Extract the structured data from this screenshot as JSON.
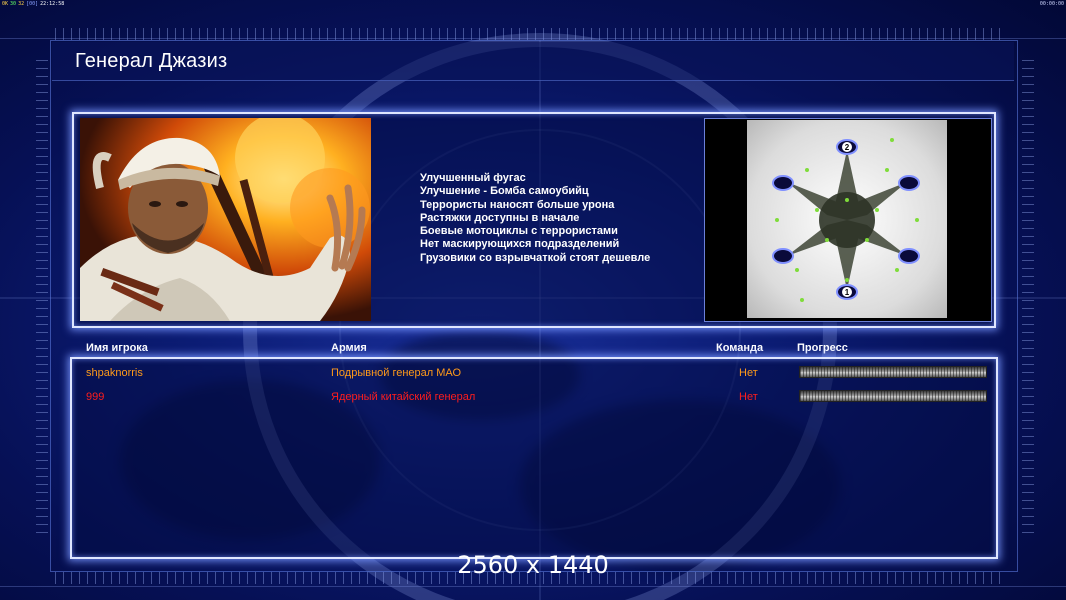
{
  "status_bar": {
    "left_items": [
      {
        "text": "0K",
        "color": "#ffd24a"
      },
      {
        "text": "30",
        "color": "#66ff66"
      },
      {
        "text": "32",
        "color": "#ffd24a"
      },
      {
        "text": "[00]",
        "color": "#8aa0ff"
      },
      {
        "text": "22:12:58",
        "color": "#ffffff"
      }
    ],
    "right_text": "00:00:00"
  },
  "title": "Генерал Джазиз",
  "general": {
    "portrait_icon": "general-portrait-image",
    "features": [
      "Улучшенный фугас",
      "Улучшение - Бомба самоубийц",
      "Террористы наносят больше урона",
      "Растяжки доступны в начале",
      "Боевые мотоциклы с террористами",
      "Нет маскирующихся подразделений",
      "Грузовики со взрывчаткой стоят дешевле"
    ]
  },
  "map": {
    "icon": "map-preview-image",
    "start_labels": [
      "2",
      "1"
    ]
  },
  "players_table": {
    "headers": {
      "name": "Имя игрока",
      "army": "Армия",
      "team": "Команда",
      "progress": "Прогресс"
    },
    "rows": [
      {
        "name": "shpaknorris",
        "army": "Подрывной генерал МАО",
        "team": "Нет",
        "color": "#ff9a1a",
        "progress": 1.0
      },
      {
        "name": "999",
        "army": "Ядерный китайский генерал",
        "team": "Нет",
        "color": "#ff1d1d",
        "progress": 1.0
      }
    ]
  },
  "resolution_label": "2560 x 1440",
  "colors": {
    "background": "#0c1c74",
    "box_border": "#dfe6ff",
    "player_orange": "#ff9a1a",
    "player_red": "#ff1d1d"
  }
}
